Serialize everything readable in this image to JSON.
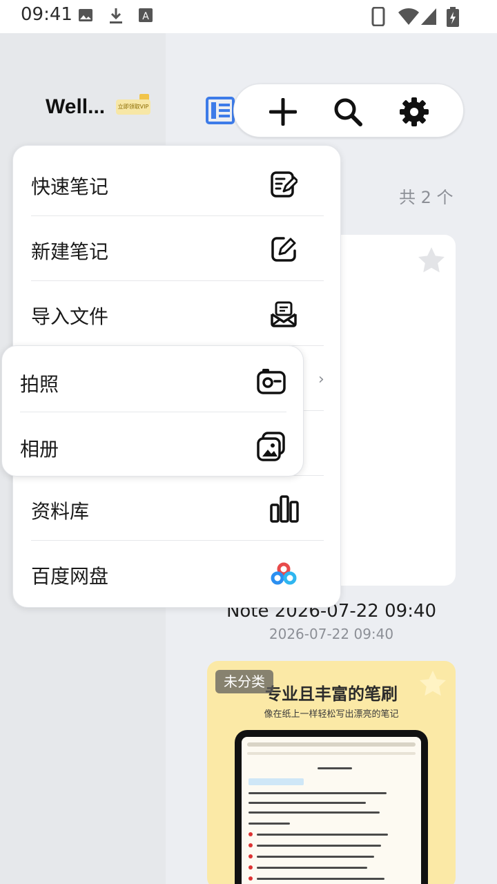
{
  "status_bar": {
    "time": "09:41",
    "icons": [
      "image-icon",
      "download-icon",
      "text-a-icon",
      "phone-icon",
      "wifi-icon",
      "signal-icon",
      "battery-charging-icon"
    ]
  },
  "header": {
    "app_title": "Well...",
    "vip_badge_text": "立即领取VIP",
    "actions": [
      "add-icon",
      "search-icon",
      "settings-icon"
    ]
  },
  "list": {
    "count_label": "共 2 个",
    "notes": [
      {
        "title": "Note 2026-07-22 09:40",
        "date": "2026-07-22 09:40"
      },
      {
        "tag": "未分类",
        "cover_headline": "专业且丰富的笔刷",
        "cover_subline": "像在纸上一样轻松写出漂亮的笔记"
      }
    ]
  },
  "menu": {
    "items": [
      {
        "label": "快速笔记",
        "icon": "quick-note-icon"
      },
      {
        "label": "新建笔记",
        "icon": "new-note-icon"
      },
      {
        "label": "导入文件",
        "icon": "import-file-icon"
      },
      {
        "label": "",
        "icon": ""
      },
      {
        "label": "",
        "icon": ""
      },
      {
        "label": "资料库",
        "icon": "library-icon"
      },
      {
        "label": "百度网盘",
        "icon": "baidu-netdisk-icon"
      }
    ],
    "submenu": [
      {
        "label": "拍照",
        "icon": "camera-icon"
      },
      {
        "label": "相册",
        "icon": "photo-album-icon"
      }
    ]
  },
  "colors": {
    "accent_blue": "#3d7be8",
    "card_yellow": "#fbe9a6",
    "baidu_blue": "#2b8ff0",
    "baidu_red": "#e84b4b"
  }
}
